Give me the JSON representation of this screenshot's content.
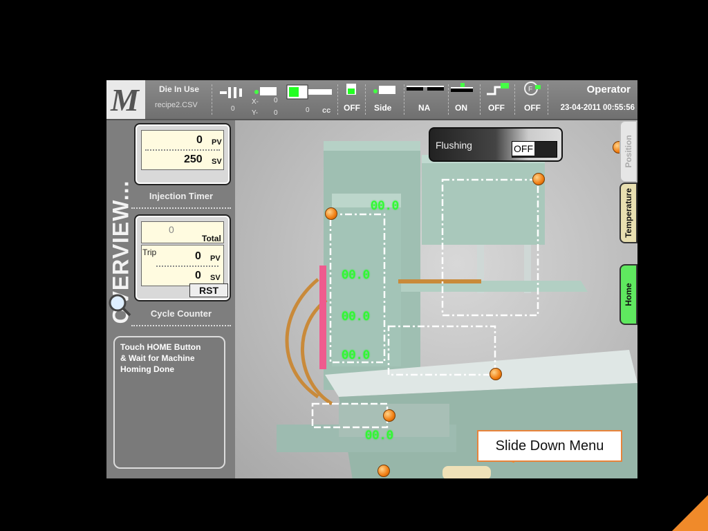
{
  "header": {
    "die_label": "Die In Use",
    "recipe": "recipe2.CSV",
    "x_label": "X-",
    "y_label": "Y-",
    "x_value": "0",
    "y_value": "0",
    "value_left": "0",
    "value_cc": "0",
    "unit_cc": "cc",
    "status": [
      "OFF",
      "Side",
      "NA",
      "ON",
      "OFF",
      "OFF"
    ],
    "operator": "Operator",
    "datetime": "23-04-2011 00:55:56"
  },
  "left_panel": {
    "overview_label": "OVERVIEW...",
    "injection_timer": {
      "caption": "Injection Timer",
      "pv_value": "0",
      "pv_unit": "PV",
      "sv_value": "250",
      "sv_unit": "SV"
    },
    "cycle_counter": {
      "caption": "Cycle Counter",
      "total_value": "0",
      "total_label": "Total",
      "trip_label": "Trip",
      "pv_value": "0",
      "pv_unit": "PV",
      "sv_value": "0",
      "sv_unit": "SV",
      "reset_label": "RST"
    },
    "message": "Touch HOME Button\n& Wait for Machine\nHoming Done"
  },
  "main": {
    "flushing_label": "Flushing",
    "flushing_state": "OFF",
    "readouts": [
      "00.0",
      "00.0",
      "00.0",
      "00.0",
      "00.0"
    ],
    "tabs": [
      "Position",
      "Temperature",
      "Home"
    ]
  },
  "callout": "Slide Down Menu",
  "colors": {
    "accent": "#f08a2a",
    "segment": "#28ff28",
    "home_tab": "#5fe85f"
  }
}
